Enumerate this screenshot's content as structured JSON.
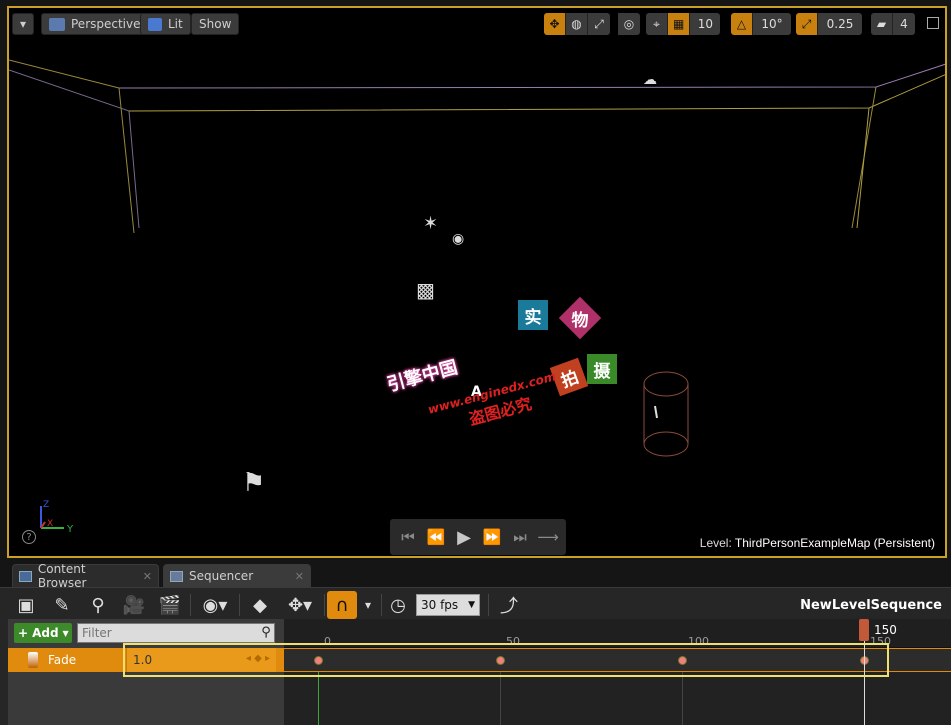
{
  "viewport": {
    "menu_button": "▾",
    "view_mode": "Perspective",
    "lighting": "Lit",
    "show": "Show",
    "grid_snap": "10",
    "rotation_snap": "10°",
    "scale_snap": "0.25",
    "camera_speed": "4",
    "level_label": "Level:",
    "level_name": "ThirdPersonExampleMap (Persistent)",
    "axis_x": "X",
    "axis_y": "Y",
    "axis_z": "Z",
    "help": "?"
  },
  "watermark": {
    "line1": "引擎中国",
    "url": "www.enginedx.com",
    "line3": "盗图必究",
    "box1": "实",
    "box2": "物",
    "box3": "拍",
    "box4": "摄"
  },
  "tabs": [
    {
      "label": "Content Browser",
      "close": "✕"
    },
    {
      "label": "Sequencer",
      "close": "✕"
    }
  ],
  "sequencer": {
    "fps": "30 fps",
    "sequence_name": "NewLevelSequence",
    "add_label": "Add",
    "filter_placeholder": "Filter",
    "track_name": "Fade",
    "track_value": "1.0",
    "key_nav": "◂ ◆ ▸",
    "playhead_frame": "150",
    "ruler_ticks": [
      "0",
      "50",
      "100",
      "150"
    ]
  },
  "colors": {
    "accent_orange": "#e08a0e",
    "selection_yellow": "#f0e070",
    "keyframe": "#ee8080"
  }
}
